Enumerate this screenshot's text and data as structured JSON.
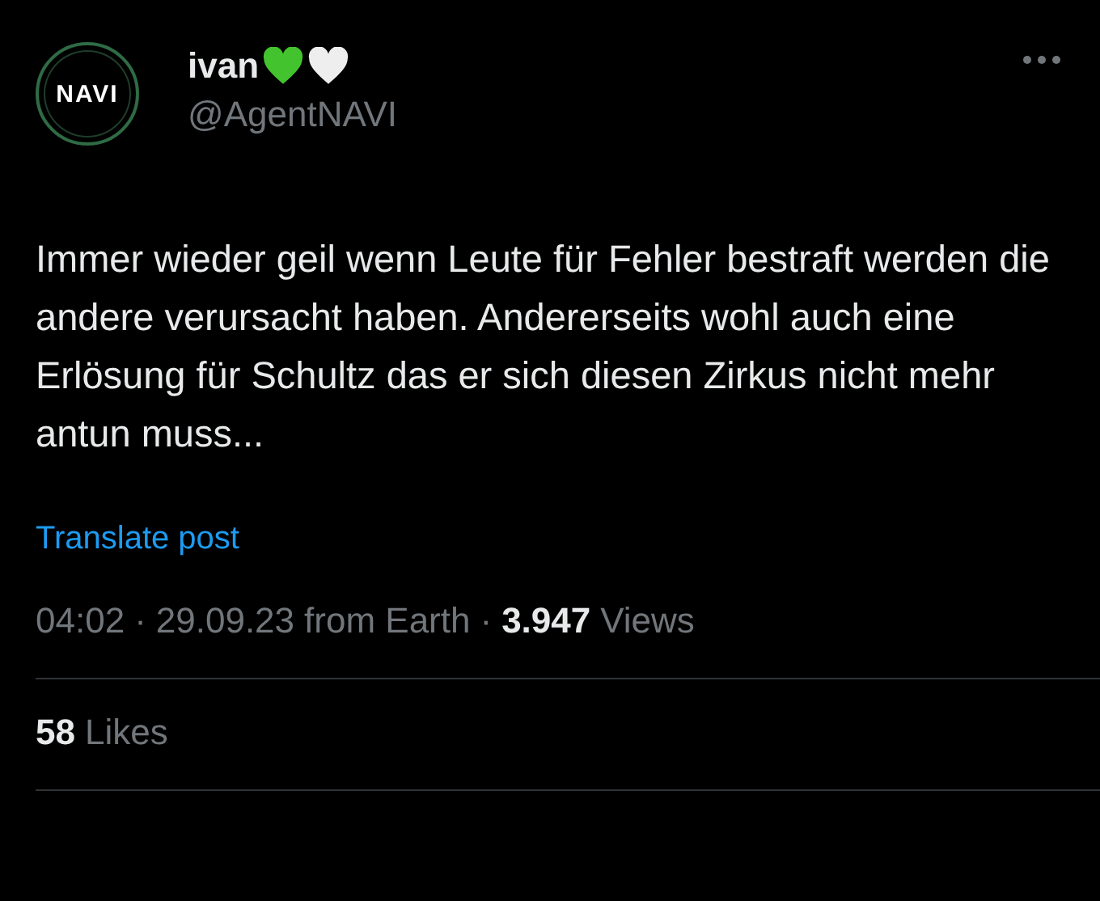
{
  "author": {
    "avatar_text": "NAVI",
    "name": "ivan",
    "handle": "@AgentNAVI"
  },
  "body": "Immer wieder geil wenn Leute für Fehler bestraft werden die andere verursacht haben. Andererseits wohl auch eine Erlösung für Schultz das er sich diesen Zirkus nicht mehr antun muss...",
  "translate_link": "Translate post",
  "meta": {
    "time": "04:02",
    "date": "29.09.23",
    "origin": "from Earth",
    "views_count": "3.947",
    "views_label": "Views",
    "separator": "·"
  },
  "likes": {
    "count": "58",
    "label": "Likes"
  }
}
